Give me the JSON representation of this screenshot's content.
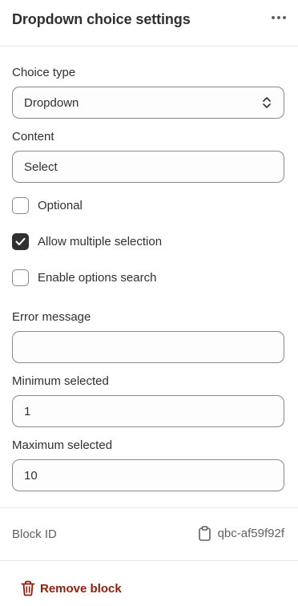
{
  "header": {
    "title": "Dropdown choice settings",
    "more_icon": "more-horizontal-icon"
  },
  "choice_type": {
    "label": "Choice type",
    "value": "Dropdown",
    "icon": "select-chevrons-icon"
  },
  "content": {
    "label": "Content",
    "value": "Select"
  },
  "checkboxes": [
    {
      "label": "Optional",
      "checked": false
    },
    {
      "label": "Allow multiple selection",
      "checked": true
    },
    {
      "label": "Enable options search",
      "checked": false
    }
  ],
  "error_message": {
    "label": "Error message",
    "value": ""
  },
  "minimum_selected": {
    "label": "Minimum selected",
    "value": "1"
  },
  "maximum_selected": {
    "label": "Maximum selected",
    "value": "10"
  },
  "block_id": {
    "label": "Block ID",
    "value": "qbc-af59f92f",
    "icon": "clipboard-icon"
  },
  "remove": {
    "label": "Remove block",
    "icon": "trash-icon"
  },
  "colors": {
    "text": "#303030",
    "muted": "#616161",
    "border": "#8a8a8a",
    "critical": "#8e1f0b",
    "divider": "#e6e6e6"
  }
}
